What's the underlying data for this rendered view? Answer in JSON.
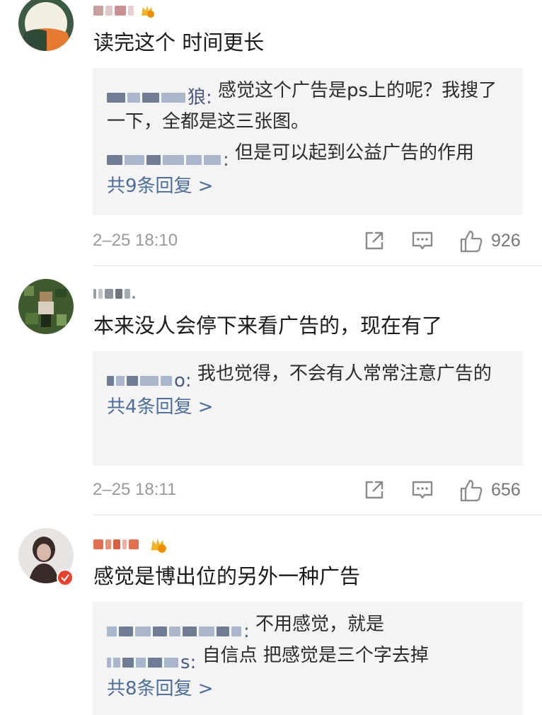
{
  "comments": [
    {
      "content": "读完这个 时间更长",
      "replies": [
        {
          "name_tail": "狼:",
          "text": " 感觉这个广告是ps上的呢？我搜了一下，全都是这三张图。"
        },
        {
          "name_tail": ":",
          "text": " 但是可以起到公益广告的作用"
        }
      ],
      "more": "共9条回复 >",
      "time": "2–25 18:10",
      "likes": "926"
    },
    {
      "content": "本来没人会停下来看广告的，现在有了",
      "replies": [
        {
          "name_tail": "o:",
          "text": " 我也觉得，不会有人常常注意广告的"
        }
      ],
      "more": "共4条回复 >",
      "time": "2–25 18:11",
      "likes": "656"
    },
    {
      "content": "感觉是博出位的另外一种广告",
      "replies": [
        {
          "name_tail": ":",
          "text": " 不用感觉，就是"
        },
        {
          "name_tail": "s:",
          "text": " 自信点 把感觉是三个字去掉"
        }
      ],
      "more": "共8条回复 >"
    }
  ],
  "colors": {
    "link": "#4d6d9c",
    "reply_bg": "#f4f4f4",
    "muted": "#9a9a9a"
  },
  "icons": [
    "share-icon",
    "comment-icon",
    "like-icon",
    "vip-badge-icon"
  ]
}
